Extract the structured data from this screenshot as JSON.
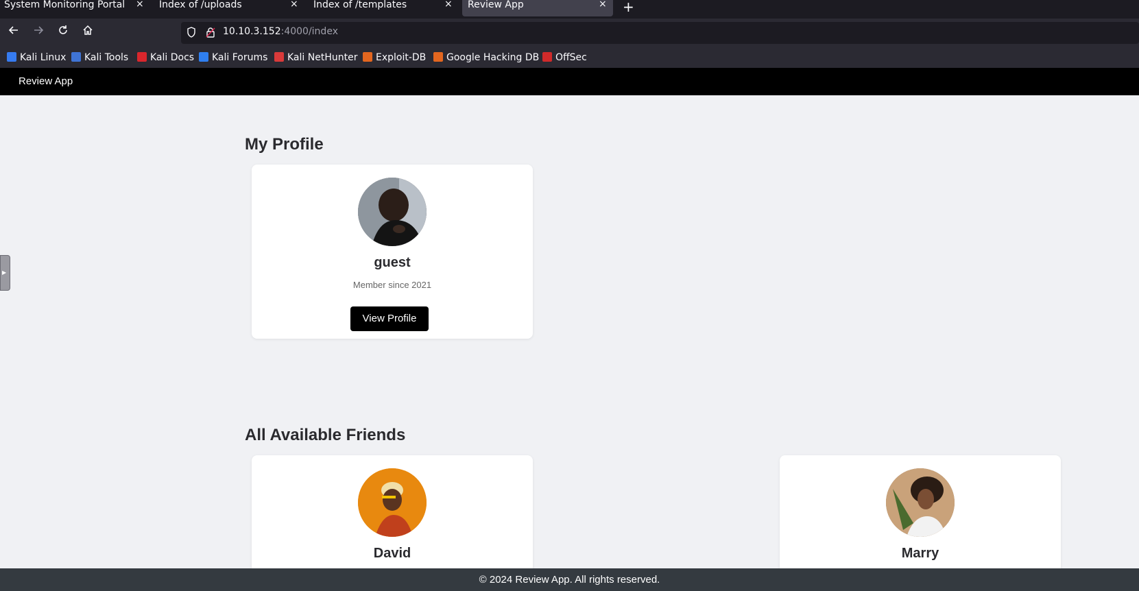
{
  "browser": {
    "tabs": [
      {
        "title": "System Monitoring Portal",
        "active": false
      },
      {
        "title": "Index of /uploads",
        "active": false
      },
      {
        "title": "Index of /templates",
        "active": false
      },
      {
        "title": "Review App",
        "active": true
      }
    ],
    "close_glyph": "×",
    "newtab_glyph": "+",
    "url_host": "10.10.3.152",
    "url_rest": ":4000/index",
    "bookmarks": [
      {
        "label": "Kali Linux",
        "color": "#367bf0"
      },
      {
        "label": "Kali Tools",
        "color": "#3f74d6"
      },
      {
        "label": "Kali Docs",
        "color": "#d9262c"
      },
      {
        "label": "Kali Forums",
        "color": "#2f7ff0"
      },
      {
        "label": "Kali NetHunter",
        "color": "#d93a3a"
      },
      {
        "label": "Exploit-DB",
        "color": "#e3661f"
      },
      {
        "label": "Google Hacking DB",
        "color": "#e3661f"
      },
      {
        "label": "OffSec",
        "color": "#d02a2a"
      }
    ]
  },
  "app": {
    "brand": "Review App",
    "my_profile": {
      "heading": "My Profile",
      "name": "guest",
      "member_since": "Member since 2021",
      "button": "View Profile"
    },
    "friends": {
      "heading": "All Available Friends",
      "items": [
        {
          "name": "David",
          "avatar_bg": "#e8890f"
        },
        {
          "name": "Marry",
          "avatar_bg": "#8a6a4a"
        }
      ]
    },
    "footer": "© 2024 Review App. All rights reserved."
  },
  "icons": [
    "back-arrow-icon",
    "forward-arrow-icon",
    "reload-icon",
    "home-icon",
    "shield-icon",
    "lock-icon"
  ]
}
